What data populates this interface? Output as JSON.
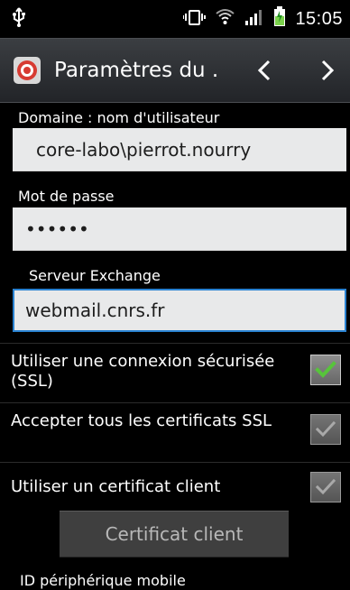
{
  "status": {
    "time": "15:05"
  },
  "header": {
    "title": "Paramètres du ."
  },
  "form": {
    "domain_label": "Domaine : nom d'utilisateur",
    "domain_value": "core-labo\\pierrot.nourry",
    "password_label": "Mot de passe",
    "password_value": "••••••",
    "server_label": "Serveur Exchange",
    "server_value": "webmail.cnrs.fr"
  },
  "options": [
    {
      "label": "Utiliser une connexion sécurisée (SSL)",
      "checked": true,
      "active": true
    },
    {
      "label": "Accepter tous les certificats SSL",
      "checked": true,
      "active": false
    },
    {
      "label": "Utiliser un certificat client",
      "checked": true,
      "active": false
    }
  ],
  "buttons": {
    "client_certificate": "Certificat client"
  },
  "bottom": {
    "mobile_device_id_label": "ID périphérique mobile"
  },
  "colors": {
    "active_field_border": "#2a82d1",
    "checkmark_green": "#57c43b"
  },
  "icons": {
    "usb": "usb-icon",
    "vibrate": "vibrate-icon",
    "wifi": "wifi-icon",
    "signal": "signal-icon",
    "battery": "battery-icon",
    "email_app": "email-app-icon",
    "back": "chevron-left-icon",
    "forward": "chevron-right-icon"
  }
}
